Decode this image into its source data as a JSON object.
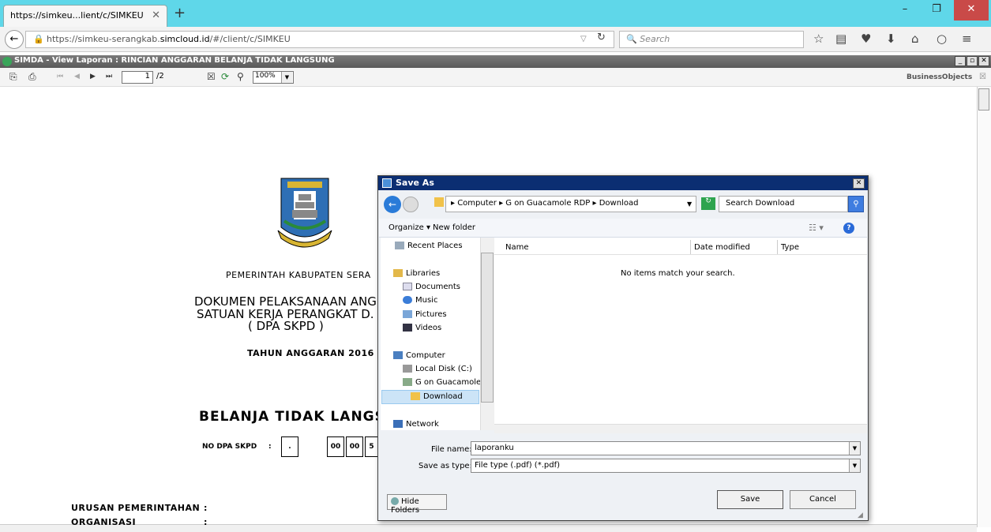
{
  "browser": {
    "tab_title": "https://simkeu...lient/c/SIMKEU",
    "tab_close": "✕",
    "new_tab": "+",
    "url_prefix": "https://simkeu-serangkab.",
    "url_domain": "simcloud.id",
    "url_suffix": "/#/client/c/SIMKEU",
    "search_placeholder": "Search",
    "search_icon": "search-icon"
  },
  "app": {
    "title": "SIMDA - View Laporan : RINCIAN ANGGARAN BELANJA TIDAK LANGSUNG",
    "page_current": "1",
    "page_total": "/2",
    "zoom": "100%",
    "brand": "BusinessObjects"
  },
  "report": {
    "government": "PEMERINTAH KABUPATEN SERA",
    "doc_line1": "DOKUMEN PELAKSANAAN ANG",
    "doc_line2": "SATUAN KERJA PERANGKAT D.",
    "doc_line3": "( DPA SKPD )",
    "tahun": "TAHUN ANGGARAN 2016",
    "belanja": "BELANJA TIDAK LANGS",
    "no_dpa_label": "NO DPA SKPD",
    "no_dpa_colon": ":",
    "dpa_boxes": [
      ".",
      "00",
      "00",
      "5"
    ],
    "urusan": "URUSAN PEMERINTAHAN",
    "organisasi": "ORGANISASI",
    "colon": ":"
  },
  "dialog": {
    "title": "Save As",
    "close": "✕",
    "breadcrumb": "▸ Computer ▸ G on Guacamole RDP ▸ Download",
    "search_placeholder": "Search Download",
    "organize": "Organize ▾",
    "new_folder": "New folder",
    "nav_items": [
      "Recent Places",
      "Libraries",
      "Documents",
      "Music",
      "Pictures",
      "Videos",
      "Computer",
      "Local Disk (C:)",
      "G on Guacamole RD",
      "Download",
      "Network"
    ],
    "columns": [
      "Name",
      "Date modified",
      "Type"
    ],
    "empty_message": "No items match your search.",
    "file_name_label": "File name:",
    "file_name_value": "laporanku",
    "save_type_label": "Save as type:",
    "save_type_value": "File type (.pdf) (*.pdf)",
    "hide_folders": "Hide Folders",
    "save": "Save",
    "cancel": "Cancel"
  },
  "colors": {
    "tabstrip": "#5fd7e9",
    "dialog_title": "#0b2e72",
    "close_red": "#c94a48",
    "nav_selected": "#cce4f7"
  }
}
